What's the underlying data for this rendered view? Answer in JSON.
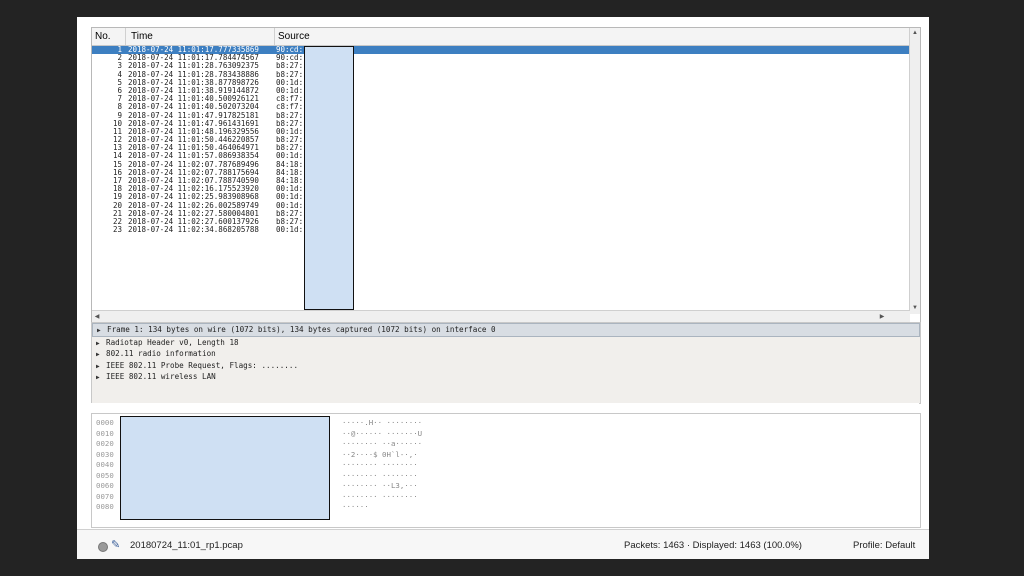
{
  "packet_list": {
    "columns": {
      "no": "No.",
      "time": "Time",
      "source": "Source"
    },
    "rows": [
      {
        "no": "1",
        "time": "2018-07-24 11:01:17.777335869",
        "source": "90:cd:"
      },
      {
        "no": "2",
        "time": "2018-07-24 11:01:17.784474567",
        "source": "90:cd:"
      },
      {
        "no": "3",
        "time": "2018-07-24 11:01:28.763092375",
        "source": "b8:27:"
      },
      {
        "no": "4",
        "time": "2018-07-24 11:01:28.783438886",
        "source": "b8:27:"
      },
      {
        "no": "5",
        "time": "2018-07-24 11:01:38.877898726",
        "source": "00:1d:"
      },
      {
        "no": "6",
        "time": "2018-07-24 11:01:38.919144872",
        "source": "00:1d:"
      },
      {
        "no": "7",
        "time": "2018-07-24 11:01:40.500926121",
        "source": "c8:f7:"
      },
      {
        "no": "8",
        "time": "2018-07-24 11:01:40.502073204",
        "source": "c8:f7:"
      },
      {
        "no": "9",
        "time": "2018-07-24 11:01:47.917825181",
        "source": "b8:27:"
      },
      {
        "no": "10",
        "time": "2018-07-24 11:01:47.961431691",
        "source": "b8:27:"
      },
      {
        "no": "11",
        "time": "2018-07-24 11:01:48.196329556",
        "source": "00:1d:"
      },
      {
        "no": "12",
        "time": "2018-07-24 11:01:50.446220857",
        "source": "b8:27:"
      },
      {
        "no": "13",
        "time": "2018-07-24 11:01:50.464064971",
        "source": "b8:27:"
      },
      {
        "no": "14",
        "time": "2018-07-24 11:01:57.086938354",
        "source": "00:1d:"
      },
      {
        "no": "15",
        "time": "2018-07-24 11:02:07.787689496",
        "source": "84:18:"
      },
      {
        "no": "16",
        "time": "2018-07-24 11:02:07.788175694",
        "source": "84:18:"
      },
      {
        "no": "17",
        "time": "2018-07-24 11:02:07.788740590",
        "source": "84:18:"
      },
      {
        "no": "18",
        "time": "2018-07-24 11:02:16.175523920",
        "source": "00:1d:"
      },
      {
        "no": "19",
        "time": "2018-07-24 11:02:25.983908968",
        "source": "00:1d:"
      },
      {
        "no": "20",
        "time": "2018-07-24 11:02:26.002589749",
        "source": "00:1d:"
      },
      {
        "no": "21",
        "time": "2018-07-24 11:02:27.580004801",
        "source": "b8:27:"
      },
      {
        "no": "22",
        "time": "2018-07-24 11:02:27.600137926",
        "source": "b8:27:"
      },
      {
        "no": "23",
        "time": "2018-07-24 11:02:34.868205788",
        "source": "00:1d:"
      }
    ]
  },
  "details": [
    "Frame 1: 134 bytes on wire (1072 bits), 134 bytes captured (1072 bits) on interface 0",
    "Radiotap Header v0, Length 18",
    "802.11 radio information",
    "IEEE 802.11 Probe Request, Flags: ........",
    "IEEE 802.11 wireless LAN"
  ],
  "bytes": {
    "offsets": [
      "0000",
      "0010",
      "0020",
      "0030",
      "0040",
      "0050",
      "0060",
      "0070",
      "0080"
    ],
    "ascii": [
      "·····.H·· ········",
      "··@······ ·······U",
      "········ ··a······",
      "··2····$ 0H`l-·,·",
      "········ ········",
      "········ ········",
      "········ ··L3,···",
      "········ ········",
      "······"
    ]
  },
  "status": {
    "filename": "20180724_11:01_rp1.pcap",
    "packets": "Packets: 1463 · Displayed: 1463 (100.0%)",
    "profile": "Profile: Default",
    "status_icon": "ready-dot-icon",
    "edit_icon": "pencil-icon"
  },
  "colors": {
    "selection": "#3d7fc1",
    "redaction": "#cfe0f3"
  }
}
